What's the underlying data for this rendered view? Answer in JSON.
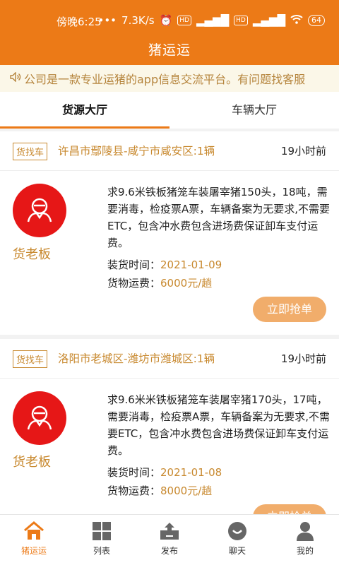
{
  "status_bar": {
    "time": "傍晚6:25",
    "network_speed": "7.3K/s",
    "battery": "64"
  },
  "header": {
    "title": "猪运运"
  },
  "notice": {
    "text": "公司是一款专业运猪的app信息交流平台。有问题找客服"
  },
  "tabs": [
    {
      "label": "货源大厅",
      "active": true
    },
    {
      "label": "车辆大厅",
      "active": false
    }
  ],
  "listings": [
    {
      "tag": "货找车",
      "route": "许昌市鄢陵县-咸宁市咸安区:1辆",
      "time_ago": "19小时前",
      "owner": "货老板",
      "description": "求9.6米铁板猪笼车装屠宰猪150头，18吨，需要消毒，检疫票A票，车辆备案为无要求,不需要ETC，包含冲水费包含进场费保证卸车支付运费。",
      "load_time_label": "装货时间：",
      "load_time": "2021-01-09",
      "fee_label": "货物运费：",
      "fee": "6000元/趟",
      "button": "立即抢单"
    },
    {
      "tag": "货找车",
      "route": "洛阳市老城区-潍坊市潍城区:1辆",
      "time_ago": "19小时前",
      "owner": "货老板",
      "description": "求9.6米米铁板猪笼车装屠宰猪170头，17吨，需要消毒，检疫票A票，车辆备案为无要求,不需要ETC，包含冲水费包含进场费保证卸车支付运费。",
      "load_time_label": "装货时间：",
      "load_time": "2021-01-08",
      "fee_label": "货物运费：",
      "fee": "8000元/趟",
      "button": "立即抢单"
    }
  ],
  "bottom_nav": [
    {
      "label": "猪运运",
      "icon": "home-icon",
      "active": true
    },
    {
      "label": "列表",
      "icon": "grid-icon",
      "active": false
    },
    {
      "label": "发布",
      "icon": "upload-icon",
      "active": false
    },
    {
      "label": "聊天",
      "icon": "chat-icon",
      "active": false
    },
    {
      "label": "我的",
      "icon": "user-icon",
      "active": false
    }
  ],
  "colors": {
    "brand": "#ec7a17",
    "accent_text": "#c8892f",
    "avatar": "#e61717",
    "button": "#f1ad6b"
  }
}
